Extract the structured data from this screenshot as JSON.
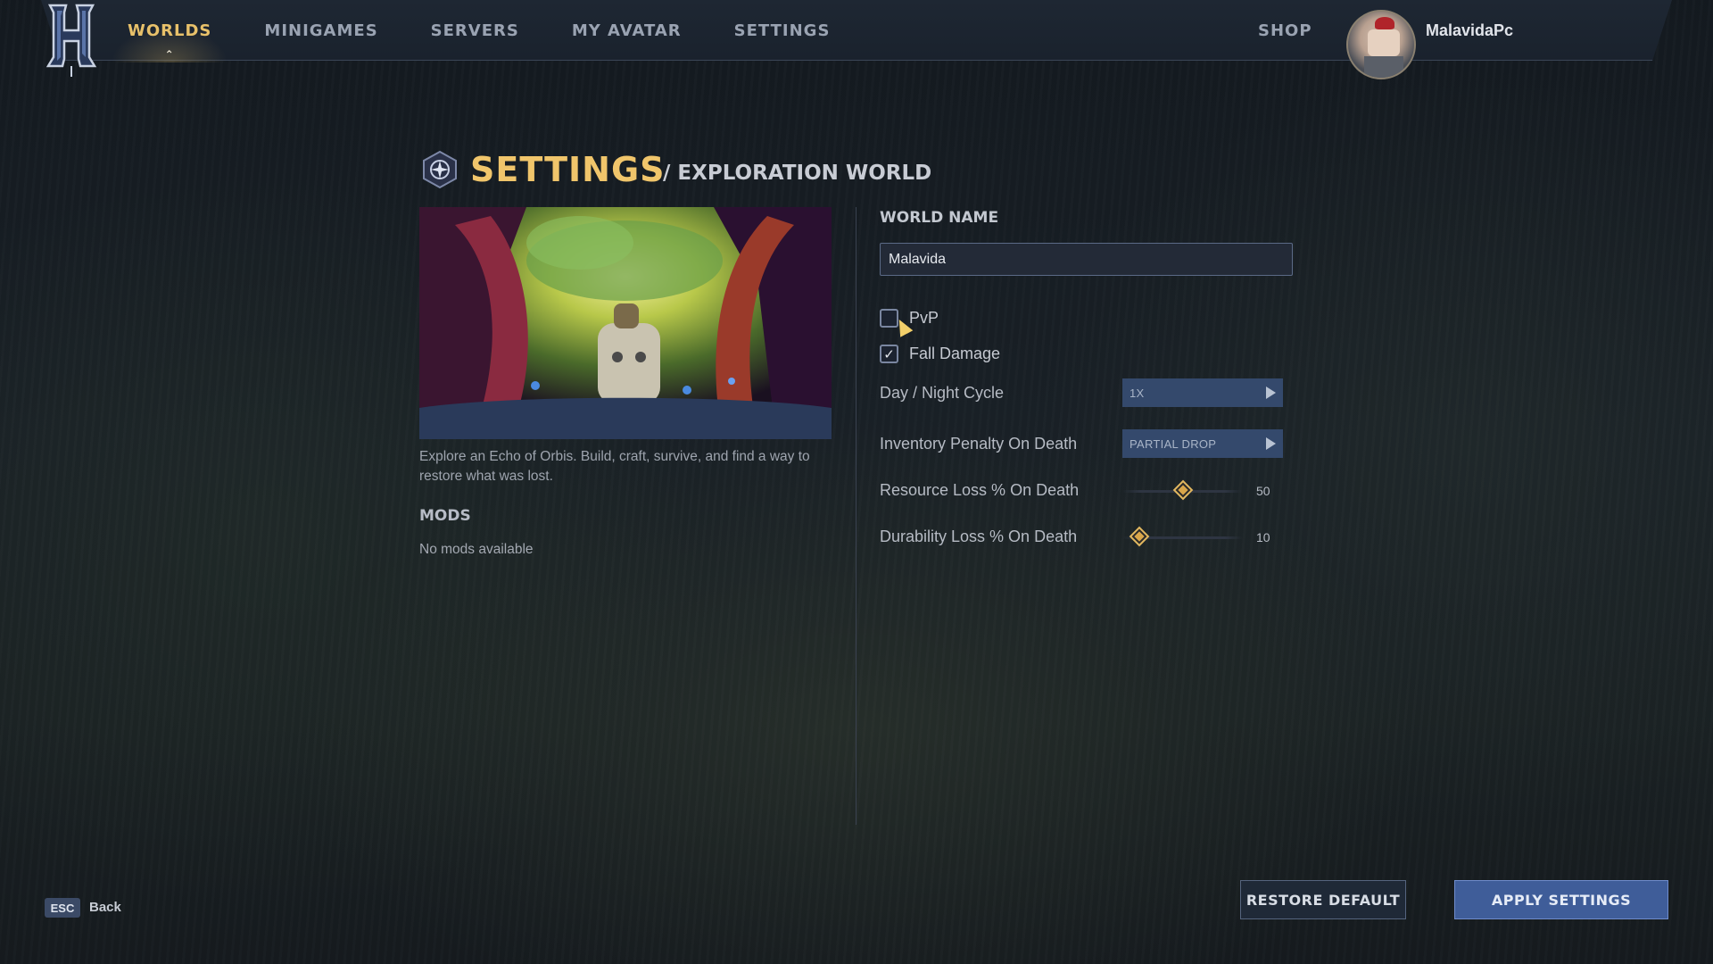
{
  "nav": {
    "items": [
      {
        "label": "WORLDS",
        "active": true
      },
      {
        "label": "MINIGAMES",
        "active": false
      },
      {
        "label": "SERVERS",
        "active": false
      },
      {
        "label": "MY AVATAR",
        "active": false
      },
      {
        "label": "SETTINGS",
        "active": false
      }
    ],
    "shop_label": "SHOP",
    "username": "MalavidaPc",
    "logo_icon": "hytale-h-logo-icon",
    "avatar_icon": "player-avatar-icon"
  },
  "header": {
    "title": "SETTINGS",
    "subtitle": "/ EXPLORATION WORLD",
    "icon": "world-emblem-icon"
  },
  "world": {
    "image_icon": "forest-preview-image",
    "description": "Explore an Echo of Orbis. Build, craft, survive, and find a way to restore what was lost.",
    "mods_heading": "MODS",
    "mods_empty": "No mods available"
  },
  "settings": {
    "world_name_label": "WORLD NAME",
    "world_name_value": "Malavida",
    "pvp": {
      "label": "PvP",
      "checked": false
    },
    "fall_damage": {
      "label": "Fall Damage",
      "checked": true
    },
    "day_night": {
      "label": "Day / Night Cycle",
      "value": "1X"
    },
    "inventory_penalty": {
      "label": "Inventory Penalty On Death",
      "value": "PARTIAL DROP"
    },
    "resource_loss": {
      "label": "Resource Loss % On Death",
      "value": 50,
      "display": "50"
    },
    "durability_loss": {
      "label": "Durability Loss % On Death",
      "value": 10,
      "display": "10"
    }
  },
  "footer": {
    "esc_key": "ESC",
    "back_label": "Back",
    "restore_label": "RESTORE DEFAULT",
    "apply_label": "APPLY SETTINGS"
  },
  "colors": {
    "accent_gold": "#f0c56b",
    "nav_active": "#e8c16a",
    "apply_button": "#3f5d99",
    "select_bg": "#34496c"
  }
}
